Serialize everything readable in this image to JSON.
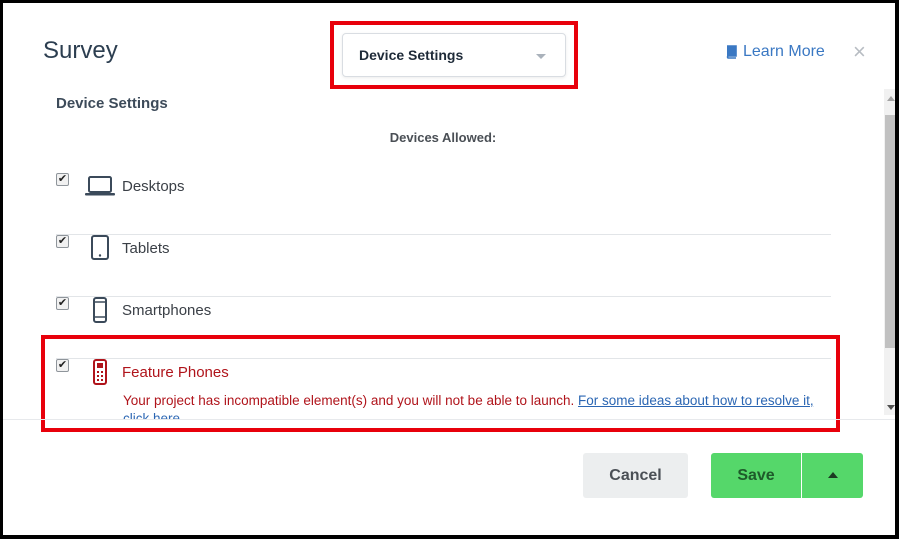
{
  "dialog": {
    "title": "Survey",
    "close_icon": "×",
    "learn_more": {
      "label": "Learn More",
      "icon": "book-icon"
    }
  },
  "dropdown": {
    "selected": "Device Settings"
  },
  "section": {
    "title": "Device Settings",
    "devices_allowed_label": "Devices Allowed:"
  },
  "devices": [
    {
      "label": "Desktops",
      "checked": true,
      "icon": "laptop-icon"
    },
    {
      "label": "Tablets",
      "checked": true,
      "icon": "tablet-icon"
    },
    {
      "label": "Smartphones",
      "checked": true,
      "icon": "smartphone-icon"
    },
    {
      "label": "Feature Phones",
      "checked": true,
      "icon": "feature-phone-icon"
    }
  ],
  "warning": {
    "message": "Your project has incompatible element(s) and you will not be able to launch.",
    "link_text": "For some ideas about how to resolve it, click here."
  },
  "footer": {
    "cancel_label": "Cancel",
    "save_label": "Save"
  },
  "colors": {
    "highlight": "#e8000b",
    "save_green": "#55d76a",
    "warning_red": "#b0141b",
    "link_blue": "#3a78c3"
  }
}
